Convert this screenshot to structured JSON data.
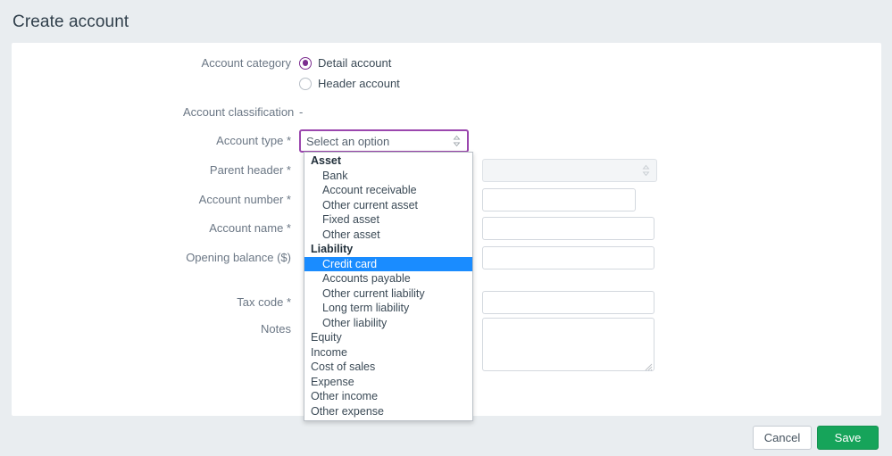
{
  "page": {
    "title": "Create account"
  },
  "form": {
    "account_category": {
      "label": "Account category",
      "options": [
        {
          "label": "Detail account",
          "selected": true
        },
        {
          "label": "Header account",
          "selected": false
        }
      ]
    },
    "account_classification": {
      "label": "Account classification",
      "value": "-"
    },
    "account_type": {
      "label": "Account type *",
      "value": "Select an option",
      "icon": "chevron-updown-icon"
    },
    "parent_header": {
      "label": "Parent header *",
      "value": "",
      "icon": "chevron-updown-icon"
    },
    "account_number": {
      "label": "Account number *",
      "value": ""
    },
    "account_name": {
      "label": "Account name *",
      "value": ""
    },
    "opening_balance": {
      "label": "Opening balance ($)",
      "value": ""
    },
    "tax_code": {
      "label": "Tax code *",
      "value": ""
    },
    "notes": {
      "label": "Notes",
      "value": ""
    }
  },
  "dropdown": {
    "highlight_color": "#1a8cff",
    "items": [
      {
        "label": "Asset",
        "type": "group"
      },
      {
        "label": "Bank",
        "type": "child"
      },
      {
        "label": "Account receivable",
        "type": "child"
      },
      {
        "label": "Other current asset",
        "type": "child"
      },
      {
        "label": "Fixed asset",
        "type": "child"
      },
      {
        "label": "Other asset",
        "type": "child"
      },
      {
        "label": "Liability",
        "type": "group"
      },
      {
        "label": "Credit card",
        "type": "child",
        "selected": true
      },
      {
        "label": "Accounts payable",
        "type": "child"
      },
      {
        "label": "Other current liability",
        "type": "child"
      },
      {
        "label": "Long term liability",
        "type": "child"
      },
      {
        "label": "Other liability",
        "type": "child"
      },
      {
        "label": "Equity",
        "type": "item"
      },
      {
        "label": "Income",
        "type": "item"
      },
      {
        "label": "Cost of sales",
        "type": "item"
      },
      {
        "label": "Expense",
        "type": "item"
      },
      {
        "label": "Other income",
        "type": "item"
      },
      {
        "label": "Other expense",
        "type": "item"
      }
    ]
  },
  "footer": {
    "cancel_label": "Cancel",
    "save_label": "Save",
    "save_color": "#16a45a"
  }
}
